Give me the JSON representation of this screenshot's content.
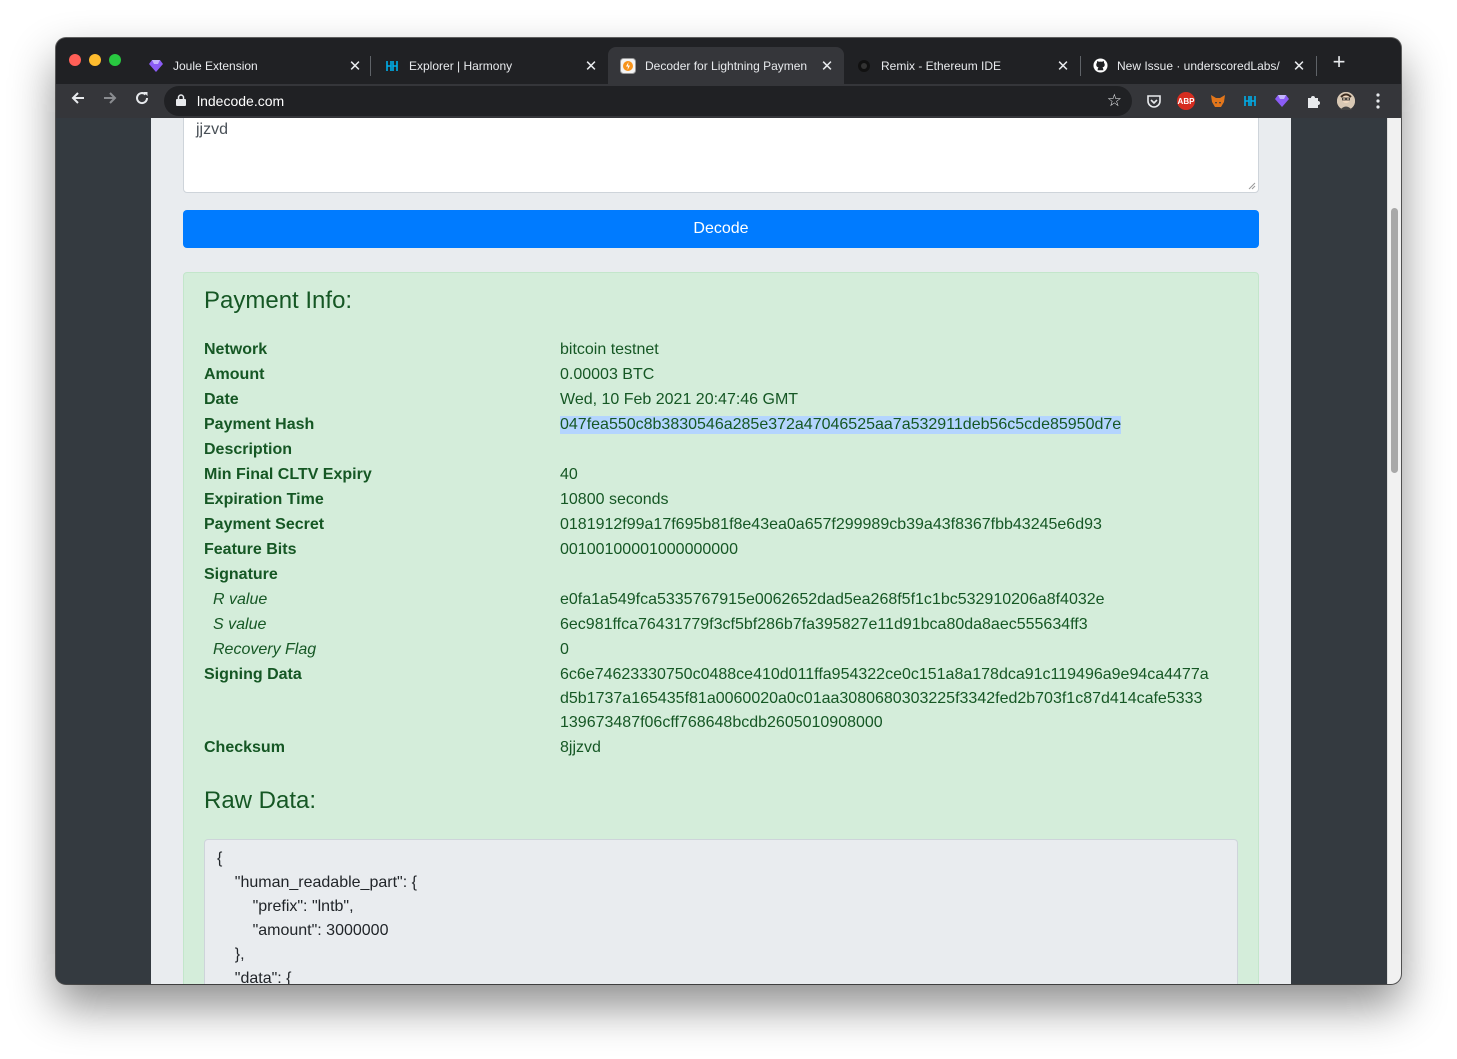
{
  "browser": {
    "tabs": [
      {
        "title": "Joule Extension",
        "icon": "gem-icon",
        "active": false
      },
      {
        "title": "Explorer | Harmony",
        "icon": "harmony-icon",
        "active": false
      },
      {
        "title": "Decoder for Lightning Paymen",
        "icon": "lightning-decoder-icon",
        "active": true
      },
      {
        "title": "Remix - Ethereum IDE",
        "icon": "remix-icon",
        "active": false
      },
      {
        "title": "New Issue · underscoredLabs/",
        "icon": "github-icon",
        "active": false
      }
    ],
    "tab_close_glyph": "✕",
    "new_tab_glyph": "+",
    "address": "lndecode.com",
    "extensions": [
      "pocket-icon",
      "adblock-plus-icon",
      "metamask-icon",
      "harmony-icon",
      "joule-icon",
      "puzzle-icon",
      "profile-avatar",
      "menu-kebab-icon"
    ],
    "abp_label": "ABP"
  },
  "form": {
    "invoice_tail": "jjzvd",
    "decode_label": "Decode"
  },
  "payment_info": {
    "heading": "Payment Info:",
    "rows": [
      {
        "label": "Network",
        "value": "bitcoin testnet"
      },
      {
        "label": "Amount",
        "value": "0.00003 BTC"
      },
      {
        "label": "Date",
        "value": "Wed, 10 Feb 2021 20:47:46 GMT"
      },
      {
        "label": "Payment Hash",
        "value": "047fea550c8b3830546a285e372a47046525aa7a532911deb56c5cde85950d7e",
        "selected": true
      },
      {
        "label": "Description",
        "value": ""
      },
      {
        "label": "Min Final CLTV Expiry",
        "value": "40"
      },
      {
        "label": "Expiration Time",
        "value": "10800 seconds"
      },
      {
        "label": "Payment Secret",
        "value": "0181912f99a17f695b81f8e43ea0a657f299989cb39a43f8367fbb43245e6d93"
      },
      {
        "label": "Feature Bits",
        "value": "00100100001000000000"
      },
      {
        "label": "Signature",
        "value": ""
      },
      {
        "label": "R value",
        "value": "e0fa1a549fca5335767915e0062652dad5ea268f5f1c1bc532910206a8f4032e",
        "sub": true
      },
      {
        "label": "S value",
        "value": "6ec981ffca76431779f3cf5bf286b7fa395827e11d91bca80da8aec555634ff3",
        "sub": true
      },
      {
        "label": "Recovery Flag",
        "value": "0",
        "sub": true
      }
    ],
    "signing_data": {
      "label": "Signing Data",
      "lines": [
        "6c6e74623330750c0488ce410d011ffa954322ce0c151a8a178dca91c119496a9e94ca4477a",
        "d5b1737a165435f81a0060020a0c01aa3080680303225f3342fed2b703f1c87d414cafe5333",
        "139673487f06cff768648bcdb2605010908000"
      ]
    },
    "checksum": {
      "label": "Checksum",
      "value": "8jjzvd"
    }
  },
  "raw_data": {
    "heading": "Raw Data:",
    "lines": [
      "{",
      "    \"human_readable_part\": {",
      "        \"prefix\": \"lntb\",",
      "        \"amount\": 3000000",
      "    },",
      "    \"data\": {"
    ]
  }
}
